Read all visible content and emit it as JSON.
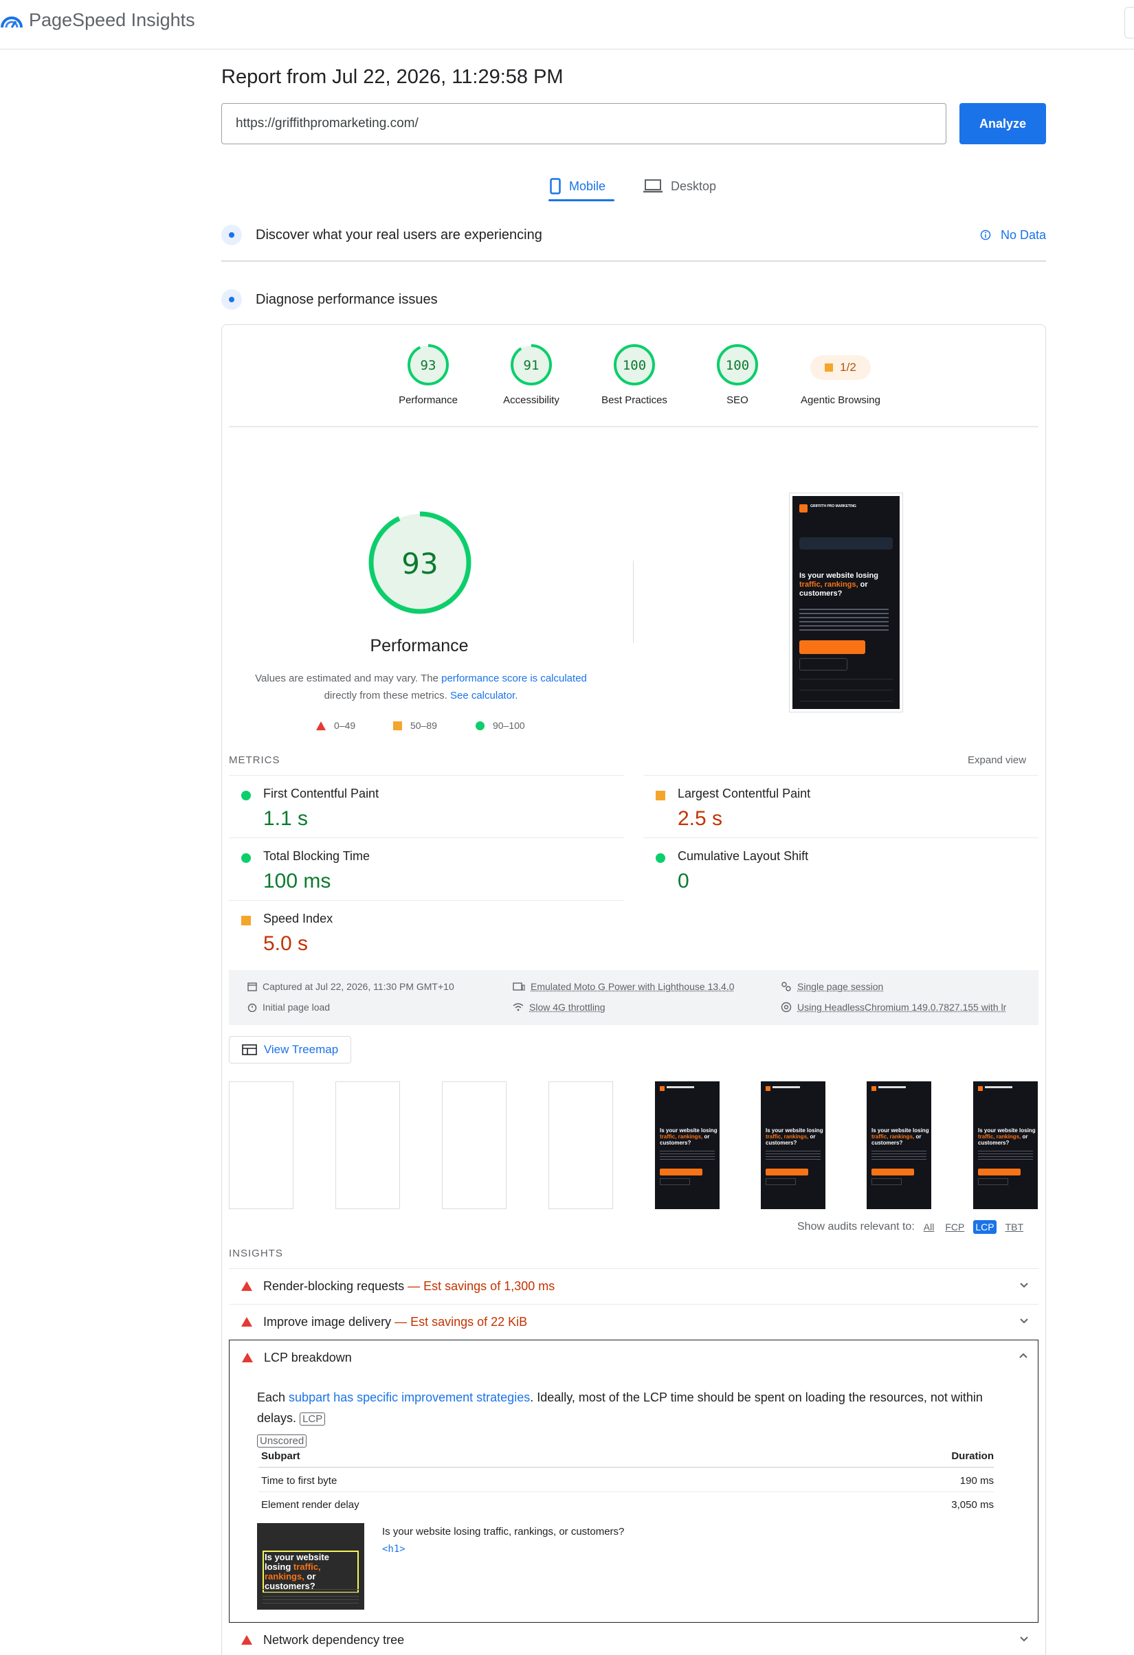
{
  "app": {
    "title": "PageSpeed Insights"
  },
  "report": {
    "title": "Report from Jul 22, 2026, 11:29:58 PM"
  },
  "search": {
    "url": "https://griffithpromarketing.com/",
    "analyze_label": "Analyze"
  },
  "tabs": [
    {
      "label": "Mobile",
      "icon": "smartphone-icon",
      "active": true
    },
    {
      "label": "Desktop",
      "icon": "laptop-icon",
      "active": false
    }
  ],
  "field_data": {
    "title": "Discover what your real users are experiencing",
    "status": "No Data"
  },
  "diagnose": {
    "title": "Diagnose performance issues"
  },
  "categories": [
    {
      "label": "Performance",
      "score": "93",
      "fraction": 0.93
    },
    {
      "label": "Accessibility",
      "score": "91",
      "fraction": 0.91
    },
    {
      "label": "Best Practices",
      "score": "100",
      "fraction": 1.0
    },
    {
      "label": "SEO",
      "score": "100",
      "fraction": 1.0
    },
    {
      "label": "Agentic Browsing",
      "score": "1/2"
    }
  ],
  "performance": {
    "score": "93",
    "fraction": 0.93,
    "label": "Performance",
    "note_prefix": "Values are estimated and may vary. The",
    "note_link1": "performance score is calculated",
    "note_mid": "directly from these metrics.",
    "note_link2": "See calculator.",
    "legend": [
      "0–49",
      "50–89",
      "90–100"
    ]
  },
  "screenshot": {
    "brand": "GRIFFITH PRO MARKETING",
    "headline_pre": "Is your website losing",
    "headline_accent": "traffic, rankings,",
    "headline_post": "or customers?"
  },
  "metrics": {
    "header": "METRICS",
    "expand_label": "Expand view",
    "items": [
      {
        "name": "First Contentful Paint",
        "value": "1.1 s",
        "rating": "good"
      },
      {
        "name": "Largest Contentful Paint",
        "value": "2.5 s",
        "rating": "average"
      },
      {
        "name": "Total Blocking Time",
        "value": "100 ms",
        "rating": "good"
      },
      {
        "name": "Cumulative Layout Shift",
        "value": "0",
        "rating": "good"
      },
      {
        "name": "Speed Index",
        "value": "5.0 s",
        "rating": "average"
      }
    ]
  },
  "environment": {
    "captured": "Captured at Jul 22, 2026, 11:30 PM GMT+10",
    "load": "Initial page load",
    "device": "Emulated Moto G Power with Lighthouse 13.4.0",
    "throttling": "Slow 4G throttling",
    "session": "Single page session",
    "browser": "Using HeadlessChromium 149.0.7827.155 with lr"
  },
  "treemap": {
    "label": "View Treemap"
  },
  "audits_filter": {
    "label": "Show audits relevant to:",
    "options": [
      "All",
      "FCP",
      "LCP",
      "TBT"
    ],
    "active": "LCP"
  },
  "insights": {
    "header": "INSIGHTS",
    "items": [
      {
        "title": "Render-blocking requests",
        "savings": "— Est savings of 1,300 ms"
      },
      {
        "title": "Improve image delivery",
        "savings": "— Est savings of 22 KiB"
      },
      {
        "title": "LCP breakdown",
        "savings": ""
      },
      {
        "title": "Network dependency tree",
        "savings": ""
      }
    ]
  },
  "lcp": {
    "desc_pre": "Each",
    "desc_link": "subpart has specific improvement strategies",
    "desc_post": ". Ideally, most of the LCP time should be spent on loading the resources, not within delays.",
    "tag_lcp": "LCP",
    "tag_unscored": "Unscored",
    "col_subpart": "Subpart",
    "col_duration": "Duration",
    "rows": [
      {
        "subpart": "Time to first byte",
        "duration": "190 ms"
      },
      {
        "subpart": "Element render delay",
        "duration": "3,050 ms"
      }
    ],
    "element_text": "Is your website losing traffic, rankings, or customers?",
    "element_node": "<h1>"
  },
  "colors": {
    "accent": "#1a73e8",
    "good": "#0cce6b",
    "average": "#f4a62a",
    "poor": "#e53935"
  }
}
